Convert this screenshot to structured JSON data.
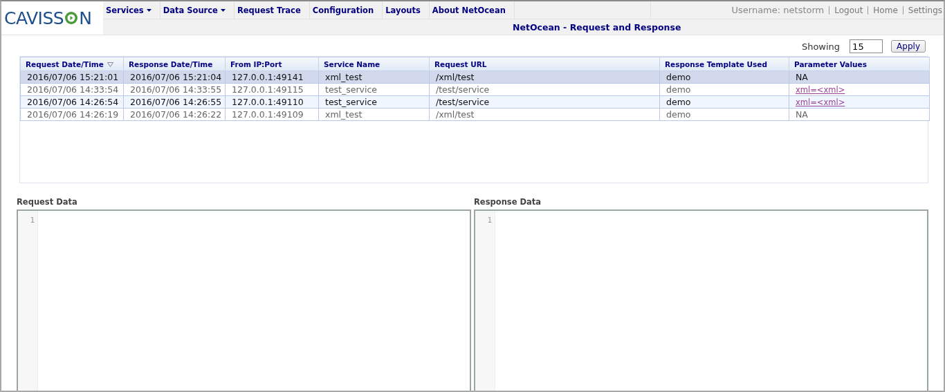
{
  "logo": {
    "text": "CAVISS",
    "text_end": "N"
  },
  "nav": [
    {
      "label": "Services",
      "dropdown": true
    },
    {
      "label": "Data Source",
      "dropdown": true
    },
    {
      "label": "Request Trace",
      "dropdown": false
    },
    {
      "label": "Configuration",
      "dropdown": false
    },
    {
      "label": "Layouts",
      "dropdown": false
    },
    {
      "label": "About NetOcean",
      "dropdown": false
    }
  ],
  "user": {
    "username": "Username: netstorm",
    "links": [
      "Logout",
      "Home",
      "Settings"
    ]
  },
  "page_title": "NetOcean - Request and Response",
  "showing": {
    "label": "Showing",
    "value": "15",
    "button": "Apply"
  },
  "table": {
    "columns": [
      {
        "label": "Request Date/Time",
        "sorted": true
      },
      {
        "label": "Response Date/Time",
        "sorted": false
      },
      {
        "label": "From IP:Port",
        "sorted": false
      },
      {
        "label": "Service Name",
        "sorted": false
      },
      {
        "label": "Request URL",
        "sorted": false
      },
      {
        "label": "Response Template Used",
        "sorted": false
      },
      {
        "label": "Parameter Values",
        "sorted": false
      }
    ],
    "rows": [
      {
        "selected": true,
        "hovered": false,
        "cells": [
          "2016/07/06 15:21:01",
          "2016/07/06 15:21:04",
          "127.0.0.1:49141",
          "xml_test",
          "/xml/test",
          "demo"
        ],
        "param": {
          "kind": "text",
          "value": "NA"
        }
      },
      {
        "selected": false,
        "hovered": false,
        "cells": [
          "2016/07/06 14:33:54",
          "2016/07/06 14:33:55",
          "127.0.0.1:49115",
          "test_service",
          "/test/service",
          "demo"
        ],
        "param": {
          "kind": "link",
          "value": "xml=<xml>"
        }
      },
      {
        "selected": false,
        "hovered": true,
        "cells": [
          "2016/07/06 14:26:54",
          "2016/07/06 14:26:55",
          "127.0.0.1:49110",
          "test_service",
          "/test/service",
          "demo"
        ],
        "param": {
          "kind": "link",
          "value": "xml=<xml>"
        }
      },
      {
        "selected": false,
        "hovered": false,
        "cells": [
          "2016/07/06 14:26:19",
          "2016/07/06 14:26:22",
          "127.0.0.1:49109",
          "xml_test",
          "/xml/test",
          "demo"
        ],
        "param": {
          "kind": "text",
          "value": "NA"
        }
      }
    ]
  },
  "editors": [
    {
      "title": "Request Data",
      "line_numbers": [
        "1"
      ]
    },
    {
      "title": "Response Data",
      "line_numbers": [
        "1"
      ]
    }
  ]
}
